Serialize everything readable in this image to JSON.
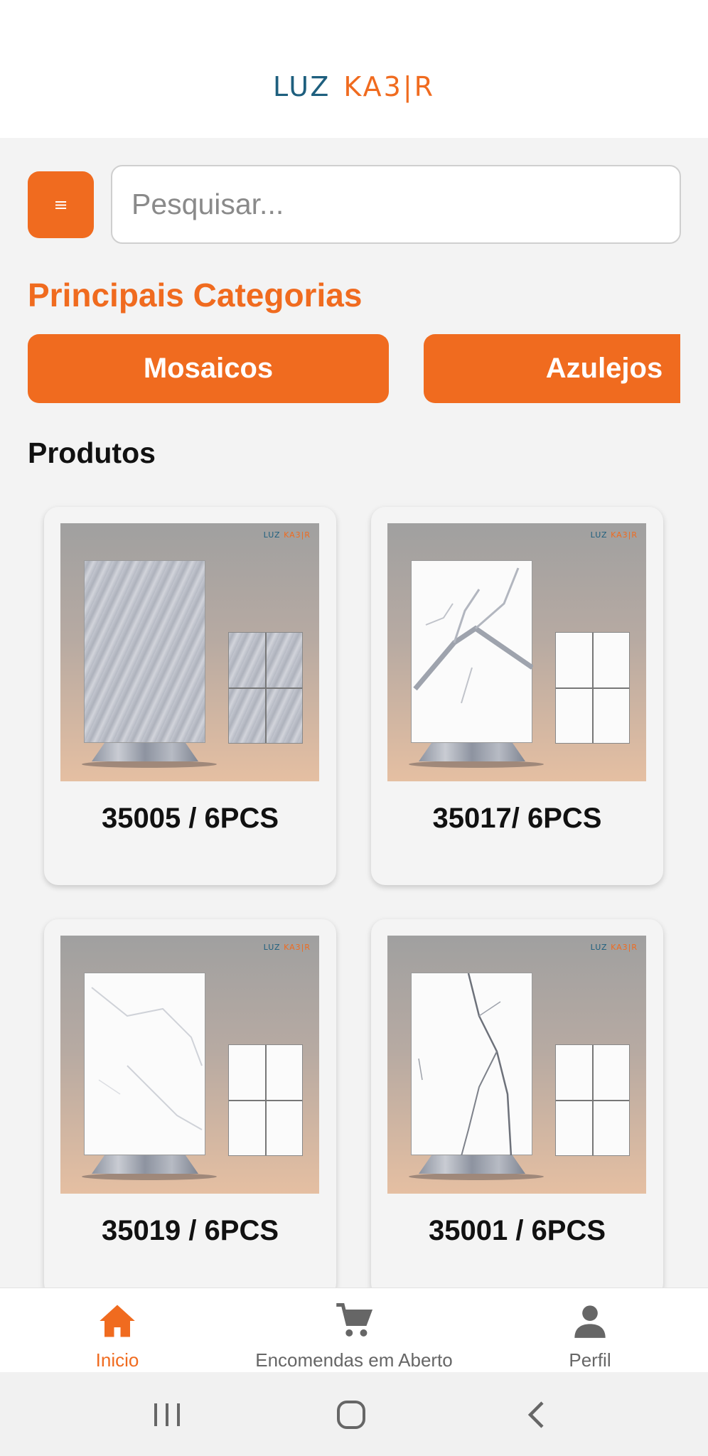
{
  "header": {
    "logo_part1": "LUZ",
    "logo_part2": "KA3|R"
  },
  "search": {
    "placeholder": "Pesquisar...",
    "menu_icon": "≡"
  },
  "categories_section": {
    "title": "Principais Categorias",
    "items": [
      {
        "label": "Mosaicos"
      },
      {
        "label": "Azulejos"
      }
    ]
  },
  "products_section": {
    "title": "Produtos",
    "items": [
      {
        "label": "35005 / 6PCS",
        "texture": "grey-marble"
      },
      {
        "label": "35017/ 6PCS",
        "texture": "white-marble-grey-veins"
      },
      {
        "label": "35019 / 6PCS",
        "texture": "white-marble-light-veins"
      },
      {
        "label": "35001 / 6PCS",
        "texture": "white-marble-dark-veins"
      }
    ],
    "image_brand_part1": "LUZ",
    "image_brand_part2": "KA3|R"
  },
  "bottom_nav": {
    "items": [
      {
        "label": "Inicio",
        "icon": "home-icon",
        "active": true
      },
      {
        "label": "Encomendas em Aberto",
        "icon": "cart-icon",
        "active": false
      },
      {
        "label": "Perfil",
        "icon": "person-icon",
        "active": false
      }
    ]
  },
  "colors": {
    "accent": "#f06b1f",
    "brand_blue": "#1e5f7e",
    "background": "#f3f3f3"
  }
}
